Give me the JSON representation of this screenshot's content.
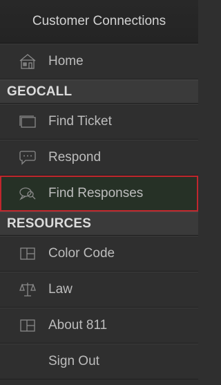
{
  "header": {
    "title": "Customer Connections"
  },
  "menu": {
    "home": {
      "label": "Home",
      "icon": "house-icon"
    },
    "geocall": {
      "title": "GEOCALL",
      "items": [
        {
          "label": "Find Ticket",
          "icon": "ticket-icon"
        },
        {
          "label": "Respond",
          "icon": "speech-bubble-icon"
        },
        {
          "label": "Find Responses",
          "icon": "search-bubble-icon",
          "active": true
        }
      ]
    },
    "resources": {
      "title": "RESOURCES",
      "items": [
        {
          "label": "Color Code",
          "icon": "panel-icon"
        },
        {
          "label": "Law",
          "icon": "scales-icon"
        },
        {
          "label": "About 811",
          "icon": "panel-icon"
        },
        {
          "label": "Sign Out",
          "icon": ""
        }
      ]
    }
  },
  "colors": {
    "active_border": "#c0272d",
    "active_bg": "#263126",
    "background": "#2f2f2f"
  }
}
